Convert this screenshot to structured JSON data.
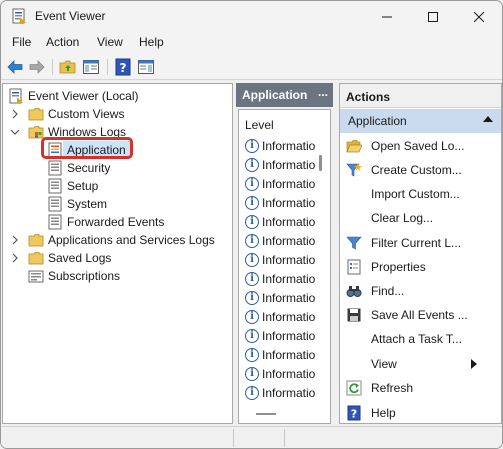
{
  "window": {
    "title": "Event Viewer"
  },
  "menu": [
    "File",
    "Action",
    "View",
    "Help"
  ],
  "toolbar": {
    "icons": [
      "back-arrow-icon",
      "forward-arrow-icon",
      "folder-up-icon",
      "show-hide-tree-icon",
      "help-icon",
      "show-hide-action-pane-icon"
    ]
  },
  "tree": {
    "root": "Event Viewer (Local)",
    "custom_views": "Custom Views",
    "windows_logs": "Windows Logs",
    "application": "Application",
    "security": "Security",
    "setup": "Setup",
    "system": "System",
    "forwarded": "Forwarded Events",
    "apps_services": "Applications and Services Logs",
    "saved_logs": "Saved Logs",
    "subscriptions": "Subscriptions"
  },
  "middle": {
    "title": "Application",
    "dots": "...",
    "column": "Level",
    "rows": [
      "Informatio",
      "Informatio",
      "Informatio",
      "Informatio",
      "Informatio",
      "Informatio",
      "Informatio",
      "Informatio",
      "Informatio",
      "Informatio",
      "Informatio",
      "Informatio",
      "Informatio",
      "Informatio"
    ]
  },
  "actions": {
    "title": "Actions",
    "section": "Application",
    "items": [
      {
        "label": "Open Saved Lo...",
        "icon": "open-folder-icon"
      },
      {
        "label": "Create Custom...",
        "icon": "filter-star-icon"
      },
      {
        "label": "Import Custom...",
        "icon": ""
      },
      {
        "label": "Clear Log...",
        "icon": ""
      },
      {
        "label": "Filter Current L...",
        "icon": "filter-icon"
      },
      {
        "label": "Properties",
        "icon": "properties-icon"
      },
      {
        "label": "Find...",
        "icon": "binoculars-icon"
      },
      {
        "label": "Save All Events ...",
        "icon": "save-icon"
      },
      {
        "label": "Attach a Task T...",
        "icon": ""
      },
      {
        "label": "View",
        "icon": ""
      },
      {
        "label": "Refresh",
        "icon": "refresh-icon"
      },
      {
        "label": "Help",
        "icon": "help-icon"
      }
    ]
  },
  "colors": {
    "selection": "#cde3f7",
    "highlight_box": "#d9302c",
    "pane_header": "#6b7480",
    "actions_section": "#c9d9ee"
  }
}
